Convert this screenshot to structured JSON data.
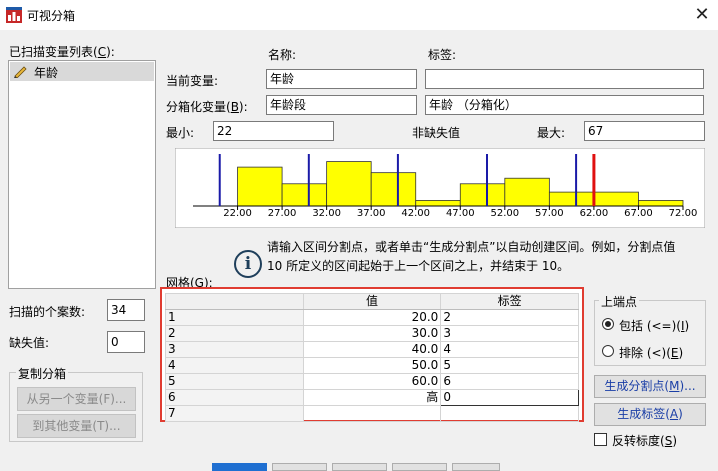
{
  "window": {
    "title": "可视分箱"
  },
  "scanned_list": {
    "label": "已扫描变量列表(",
    "mnemonic": "C",
    "label_end": "):",
    "items": [
      "年龄"
    ]
  },
  "headers": {
    "name": "名称:",
    "tag": "标签:"
  },
  "current_variable": {
    "label": "当前变量:",
    "name": "年龄",
    "tag": ""
  },
  "binned_variable": {
    "label": "分箱化变量(",
    "mnemonic": "B",
    "label_end": "):",
    "name": "年龄段",
    "tag": "年龄 （分箱化）"
  },
  "min": {
    "label": "最小:",
    "value": "22"
  },
  "nonmissing": {
    "label": "非缺失值"
  },
  "max": {
    "label": "最大:",
    "value": "67"
  },
  "chart_data": {
    "type": "bar",
    "x_ticks": [
      "22.00",
      "27.00",
      "32.00",
      "37.00",
      "42.00",
      "47.00",
      "52.00",
      "57.00",
      "62.00",
      "67.00",
      "72.00"
    ],
    "x_range": [
      17,
      72
    ],
    "bins": [
      {
        "start": 22,
        "end": 27,
        "freq": 14
      },
      {
        "start": 27,
        "end": 32,
        "freq": 8
      },
      {
        "start": 32,
        "end": 37,
        "freq": 16
      },
      {
        "start": 37,
        "end": 42,
        "freq": 12
      },
      {
        "start": 42,
        "end": 47,
        "freq": 2
      },
      {
        "start": 47,
        "end": 52,
        "freq": 8
      },
      {
        "start": 52,
        "end": 57,
        "freq": 10
      },
      {
        "start": 57,
        "end": 62,
        "freq": 5
      },
      {
        "start": 62,
        "end": 67,
        "freq": 5
      },
      {
        "start": 67,
        "end": 72,
        "freq": 2
      }
    ],
    "max_freq": 18,
    "cutpoints": [
      20,
      30,
      40,
      50,
      60
    ],
    "highlight_cutpoint": 62,
    "colors": {
      "bar": "#ffff00",
      "cutpoint": "#1a1aa8",
      "highlight": "#e01010"
    }
  },
  "info": {
    "line1": "请输入区间分割点，或者单击“生成分割点”以自动创建区间。例如，分割点值",
    "line2": "10 所定义的区间起始于上一个区间之上，并结束于 10。"
  },
  "grid": {
    "label": "网格(G):",
    "col_value": "值",
    "col_label": "标签",
    "rows": [
      {
        "num": "1",
        "value": "20.0",
        "label": "2"
      },
      {
        "num": "2",
        "value": "30.0",
        "label": "3"
      },
      {
        "num": "3",
        "value": "40.0",
        "label": "4"
      },
      {
        "num": "4",
        "value": "50.0",
        "label": "5"
      },
      {
        "num": "5",
        "value": "60.0",
        "label": "6"
      },
      {
        "num": "6",
        "value": "高",
        "label": "0"
      },
      {
        "num": "7",
        "value": "",
        "label": ""
      }
    ]
  },
  "scan_cases": {
    "label": "扫描的个案数:",
    "value": "34"
  },
  "missing": {
    "label": "缺失值:",
    "value": "0"
  },
  "copy_bins": {
    "title": "复制分箱",
    "from_other": "从另一个变量(F)...",
    "to_other": "到其他变量(T)..."
  },
  "endpoint": {
    "title": "上端点",
    "include": "包括 (<=)(",
    "include_m": "I",
    "exclude": "排除 (<)(",
    "exclude_m": "E",
    "selected": "include"
  },
  "buttons": {
    "make_cutpoints": "生成分割点(",
    "make_cutpoints_m": "M",
    "make_labels": "生成标签(",
    "make_labels_m": "A"
  },
  "reverse_scale": {
    "label": "反转标度(",
    "mnemonic": "S",
    "checked": false
  }
}
